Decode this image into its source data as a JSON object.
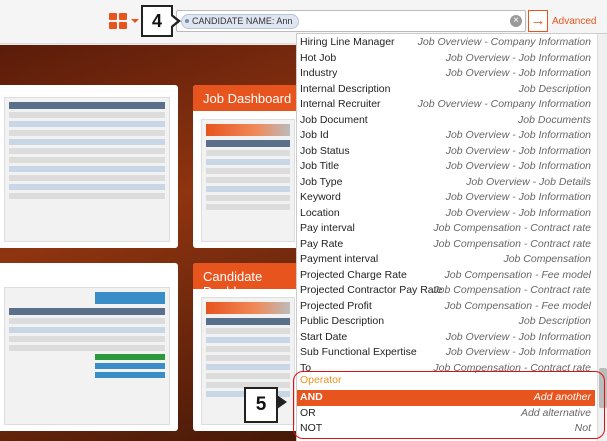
{
  "header": {
    "search": {
      "chip_field": "CANDIDATE NAME:",
      "chip_value": "Ann",
      "clear_symbol": "×",
      "go_symbol": "→"
    },
    "advanced_label": "Advanced",
    "icons": {
      "apps": "grid-icon",
      "go": "arrow-right-icon",
      "clear": "close-icon"
    }
  },
  "callouts": {
    "c4": "4",
    "c5": "5"
  },
  "cards": [
    {
      "title": ""
    },
    {
      "title": "Job Dashboard"
    },
    {
      "title": ""
    },
    {
      "title": "Candidate Dashb"
    }
  ],
  "dropdown": {
    "fields": [
      {
        "label": "Hiring Line Manager",
        "category": "Job Overview - Company Information"
      },
      {
        "label": "Hot Job",
        "category": "Job Overview - Job Information"
      },
      {
        "label": "Industry",
        "category": "Job Overview - Job Information"
      },
      {
        "label": "Internal Description",
        "category": "Job Description"
      },
      {
        "label": "Internal Recruiter",
        "category": "Job Overview - Company Information"
      },
      {
        "label": "Job Document",
        "category": "Job Documents"
      },
      {
        "label": "Job Id",
        "category": "Job Overview - Job Information"
      },
      {
        "label": "Job Status",
        "category": "Job Overview - Job Information"
      },
      {
        "label": "Job Title",
        "category": "Job Overview - Job Information"
      },
      {
        "label": "Job Type",
        "category": "Job Overview - Job Details"
      },
      {
        "label": "Keyword",
        "category": "Job Overview - Job Information"
      },
      {
        "label": "Location",
        "category": "Job Overview - Job Information"
      },
      {
        "label": "Pay interval",
        "category": "Job Compensation - Contract rate"
      },
      {
        "label": "Pay Rate",
        "category": "Job Compensation - Contract rate"
      },
      {
        "label": "Payment interval",
        "category": "Job Compensation"
      },
      {
        "label": "Projected Charge Rate",
        "category": "Job Compensation - Fee model"
      },
      {
        "label": "Projected Contractor Pay Rate",
        "category": "Job Compensation - Contract rate"
      },
      {
        "label": "Projected Profit",
        "category": "Job Compensation - Fee model"
      },
      {
        "label": "Public Description",
        "category": "Job Description"
      },
      {
        "label": "Start Date",
        "category": "Job Overview - Job Information"
      },
      {
        "label": "Sub Functional Expertise",
        "category": "Job Overview - Job Information"
      },
      {
        "label": "To",
        "category": "Job Compensation - Contract rate"
      }
    ],
    "operator_heading": "Operator",
    "operators": [
      {
        "label": "AND",
        "hint": "Add another",
        "selected": true
      },
      {
        "label": "OR",
        "hint": "Add alternative",
        "selected": false
      },
      {
        "label": "NOT",
        "hint": "Not",
        "selected": false
      }
    ]
  },
  "colors": {
    "accent": "#e8541e",
    "operator_heading": "#e8941e",
    "callout_border": "#222222",
    "highlight_border": "#dd1111"
  }
}
